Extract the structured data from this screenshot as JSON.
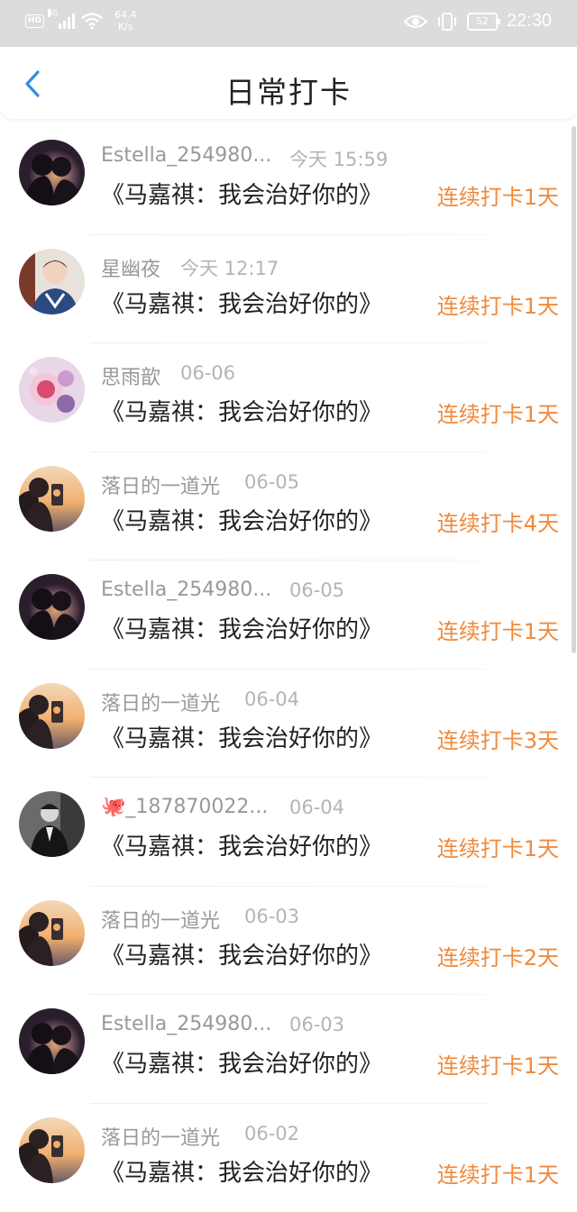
{
  "status_bar": {
    "hd": "HD",
    "network": "4G",
    "speed_value": "64.4",
    "speed_unit": "K/s",
    "battery": "52",
    "time": "22:30"
  },
  "header": {
    "title": "日常打卡",
    "back_icon": "chevron-left-icon"
  },
  "checkins": [
    {
      "name": "Estella_254980...",
      "date": "今天 15:59",
      "book": "《马嘉祺：我会治好你的》",
      "streak": "连续打卡1天",
      "avatar": "couple-silhouette"
    },
    {
      "name": "星幽夜",
      "date": "今天 12:17",
      "book": "《马嘉祺：我会治好你的》",
      "streak": "连续打卡1天",
      "avatar": "boy-photo"
    },
    {
      "name": "思雨歆",
      "date": "06-06",
      "book": "《马嘉祺：我会治好你的》",
      "streak": "连续打卡1天",
      "avatar": "pink-art"
    },
    {
      "name": "落日的一道光",
      "date": "06-05",
      "book": "《马嘉祺：我会治好你的》",
      "streak": "连续打卡4天",
      "avatar": "sunset-phone"
    },
    {
      "name": "Estella_254980...",
      "date": "06-05",
      "book": "《马嘉祺：我会治好你的》",
      "streak": "连续打卡1天",
      "avatar": "couple-silhouette"
    },
    {
      "name": "落日的一道光",
      "date": "06-04",
      "book": "《马嘉祺：我会治好你的》",
      "streak": "连续打卡3天",
      "avatar": "sunset-phone"
    },
    {
      "name": "🐙_187870022...",
      "date": "06-04",
      "book": "《马嘉祺：我会治好你的》",
      "streak": "连续打卡1天",
      "avatar": "dark-suit"
    },
    {
      "name": "落日的一道光",
      "date": "06-03",
      "book": "《马嘉祺：我会治好你的》",
      "streak": "连续打卡2天",
      "avatar": "sunset-phone"
    },
    {
      "name": "Estella_254980...",
      "date": "06-03",
      "book": "《马嘉祺：我会治好你的》",
      "streak": "连续打卡1天",
      "avatar": "couple-silhouette"
    },
    {
      "name": "落日的一道光",
      "date": "06-02",
      "book": "《马嘉祺：我会治好你的》",
      "streak": "连续打卡1天",
      "avatar": "sunset-phone"
    }
  ],
  "colors": {
    "accent_back": "#2f8fe8",
    "streak": "#f08a3c",
    "name": "#999999",
    "date": "#b4b4b4",
    "title": "#222222"
  }
}
